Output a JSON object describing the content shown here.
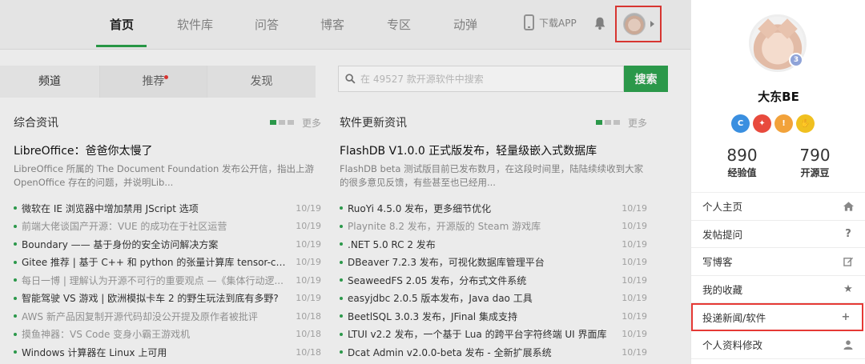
{
  "nav": {
    "items": [
      {
        "label": "首页",
        "active": true
      },
      {
        "label": "软件库",
        "active": false
      },
      {
        "label": "问答",
        "active": false
      },
      {
        "label": "博客",
        "active": false
      },
      {
        "label": "专区",
        "active": false
      },
      {
        "label": "动弹",
        "active": false
      }
    ],
    "download_label": "下载APP"
  },
  "tabs": [
    {
      "label": "频道"
    },
    {
      "label": "推荐",
      "has_dot": true
    },
    {
      "label": "发现"
    }
  ],
  "search": {
    "placeholder": "在 49527 款开源软件中搜索",
    "button_label": "搜索"
  },
  "left_column": {
    "title": "综合资讯",
    "more_label": "更多",
    "feature_title": "LibreOffice：爸爸你太慢了",
    "feature_desc": "LibreOffice 所属的 The Document Foundation 发布公开信，指出上游 OpenOffice 存在的问题，并说明Lib...",
    "items": [
      {
        "title": "微软在 IE 浏览器中增加禁用 JScript 选项",
        "date": "10/19",
        "dim": false
      },
      {
        "title": "前端大佬谈国产开源：VUE 的成功在于社区运营",
        "date": "10/19",
        "dim": true
      },
      {
        "title": "Boundary —— 基于身份的安全访问解决方案",
        "date": "10/19",
        "dim": false
      },
      {
        "title": "Gitee 推荐 | 基于 C++ 和 python 的张量计算库 tensor-calc...",
        "date": "10/19",
        "dim": false
      },
      {
        "title": "每日一博 | 理解认为开源不可行的重要观点 —《集体行动逻...",
        "date": "10/19",
        "dim": true
      },
      {
        "title": "智能驾驶 VS 游戏 | 欧洲模拟卡车 2 的野生玩法到底有多野?",
        "date": "10/19",
        "dim": false
      },
      {
        "title": "AWS 新产品因复制开源代码却没公开提及原作者被批评",
        "date": "10/18",
        "dim": true
      },
      {
        "title": "摸鱼神器：VS Code 变身小霸王游戏机",
        "date": "10/18",
        "dim": true
      },
      {
        "title": "Windows 计算器在 Linux 上可用",
        "date": "10/18",
        "dim": false
      }
    ]
  },
  "right_column": {
    "title": "软件更新资讯",
    "more_label": "更多",
    "feature_title": "FlashDB V1.0.0 正式版发布，轻量级嵌入式数据库",
    "feature_desc": "FlashDB beta 测试版目前已发布数月，在这段时间里，陆陆续续收到大家的很多意见反馈，有些甚至也已经用...",
    "items": [
      {
        "title": "RuoYi 4.5.0 发布，更多细节优化",
        "date": "10/19",
        "dim": false
      },
      {
        "title": "Playnite 8.2 发布，开源版的 Steam 游戏库",
        "date": "10/19",
        "dim": true
      },
      {
        "title": ".NET 5.0 RC 2 发布",
        "date": "10/19",
        "dim": false
      },
      {
        "title": "DBeaver 7.2.3 发布，可视化数据库管理平台",
        "date": "10/19",
        "dim": false
      },
      {
        "title": "SeaweedFS 2.05 发布，分布式文件系统",
        "date": "10/19",
        "dim": false
      },
      {
        "title": "easyjdbc 2.0.5 版本发布，Java dao 工具",
        "date": "10/19",
        "dim": false
      },
      {
        "title": "BeetlSQL 3.0.3 发布，JFinal 集成支持",
        "date": "10/19",
        "dim": false
      },
      {
        "title": "LTUI v2.2 发布，一个基于 Lua 的跨平台字符终端 UI 界面库",
        "date": "10/19",
        "dim": false
      },
      {
        "title": "Dcat Admin v2.0.0-beta 发布 - 全新扩展系统",
        "date": "10/19",
        "dim": false
      }
    ]
  },
  "profile": {
    "level": "3",
    "username": "大东BE",
    "experience_value": "890",
    "experience_label": "经验值",
    "opensource_value": "790",
    "opensource_label": "开源豆",
    "badge_colors": [
      "#3a8fe0",
      "#e84a3d",
      "#f2a23a",
      "#f0c020"
    ]
  },
  "menu": [
    {
      "label": "个人主页",
      "icon": "home-icon"
    },
    {
      "label": "发帖提问",
      "icon": "question-icon"
    },
    {
      "label": "写博客",
      "icon": "edit-icon"
    },
    {
      "label": "我的收藏",
      "icon": "star-icon"
    },
    {
      "label": "投递新闻/软件",
      "icon": "plus-icon",
      "highlighted": true
    },
    {
      "label": "个人资料修改",
      "icon": "user-icon"
    }
  ],
  "colors": {
    "accent_green": "#2ea24f",
    "highlight_red": "#e53935"
  }
}
